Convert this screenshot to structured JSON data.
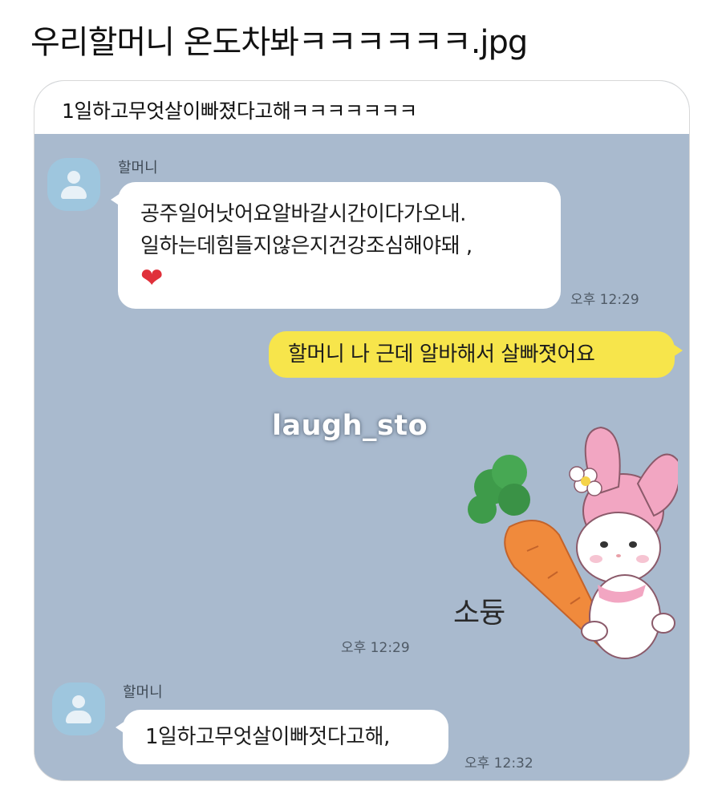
{
  "post": {
    "title": "우리할머니 온도차봐ㅋㅋㅋㅋㅋㅋ.jpg"
  },
  "card": {
    "caption": "1일하고무엇살이빠졌다고해ㅋㅋㅋㅋㅋㅋㅋ"
  },
  "chat": {
    "watermark": "laugh_sto",
    "messages": [
      {
        "sender": "할머니",
        "lines": [
          "공주일어낫어요알바갈시간이다가오내.",
          "일하는데힘들지않은지건강조심해야돼 ,"
        ],
        "emoji": "❤",
        "time": "오후 12:29"
      },
      {
        "text": "할머니 나 근데 알바해서 살빠졋어요"
      },
      {
        "sticker_text": "소듕",
        "time": "오후 12:29"
      },
      {
        "sender": "할머니",
        "text": "1일하고무엇살이빠젓다고해,",
        "time": "오후 12:32"
      }
    ]
  },
  "colors": {
    "chat_bg": "#a9bace",
    "incoming_bubble": "#ffffff",
    "outgoing_bubble": "#f7e54b",
    "avatar": "#9ec6de",
    "sticker_pink": "#f2a6c2",
    "carrot": "#f08a3c",
    "carrot_leaf": "#3e9b4a"
  }
}
